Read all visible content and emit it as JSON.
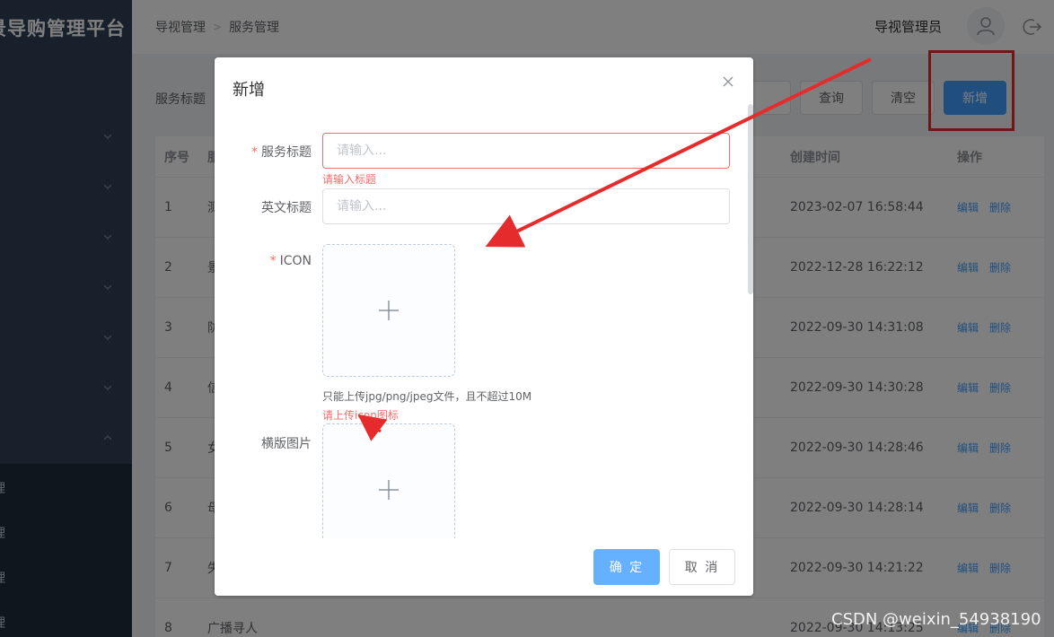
{
  "sidebar": {
    "brand": "景导购管理平台",
    "sub_items": [
      "理",
      "理",
      "理",
      "理"
    ]
  },
  "header": {
    "breadcrumb": [
      "导视管理",
      "服务管理"
    ],
    "username": "导视管理员"
  },
  "filter": {
    "label": "服务标题",
    "search_button": "查询",
    "clear_button": "清空",
    "add_button": "新增"
  },
  "table": {
    "columns": {
      "index": "序号",
      "title": "服",
      "created": "创建时间",
      "ops": "操作"
    },
    "rows": [
      {
        "index": "1",
        "title": "测",
        "created": "2023-02-07 16:58:44"
      },
      {
        "index": "2",
        "title": "景",
        "created": "2022-12-28 16:22:12"
      },
      {
        "index": "3",
        "title": "防",
        "created": "2022-09-30 14:31:08"
      },
      {
        "index": "4",
        "title": "信",
        "created": "2022-09-30 14:30:28"
      },
      {
        "index": "5",
        "title": "女",
        "created": "2022-09-30 14:28:46"
      },
      {
        "index": "6",
        "title": "母",
        "created": "2022-09-30 14:28:14"
      },
      {
        "index": "7",
        "title": "失",
        "created": "2022-09-30 14:21:22"
      },
      {
        "index": "8",
        "title": "广播寻人",
        "created": "2022-09-30 14:13:25"
      }
    ],
    "edit_label": "编辑",
    "delete_label": "删除"
  },
  "dialog": {
    "title": "新增",
    "service_title_label": "服务标题",
    "service_title_placeholder": "请输入...",
    "service_title_error": "请输入标题",
    "english_title_label": "英文标题",
    "english_title_placeholder": "请输入...",
    "icon_label": "ICON",
    "icon_tip": "只能上传jpg/png/jpeg文件，且不超过10M",
    "icon_error": "请上传icon图标",
    "banner_label": "横版图片",
    "ok_button": "确 定",
    "cancel_button": "取 消"
  },
  "watermark": "CSDN @weixin_54938190",
  "colors": {
    "primary": "#409eff",
    "danger": "#f56c6c",
    "sidebar": "#304156",
    "annotation_red": "#e52b2b"
  }
}
